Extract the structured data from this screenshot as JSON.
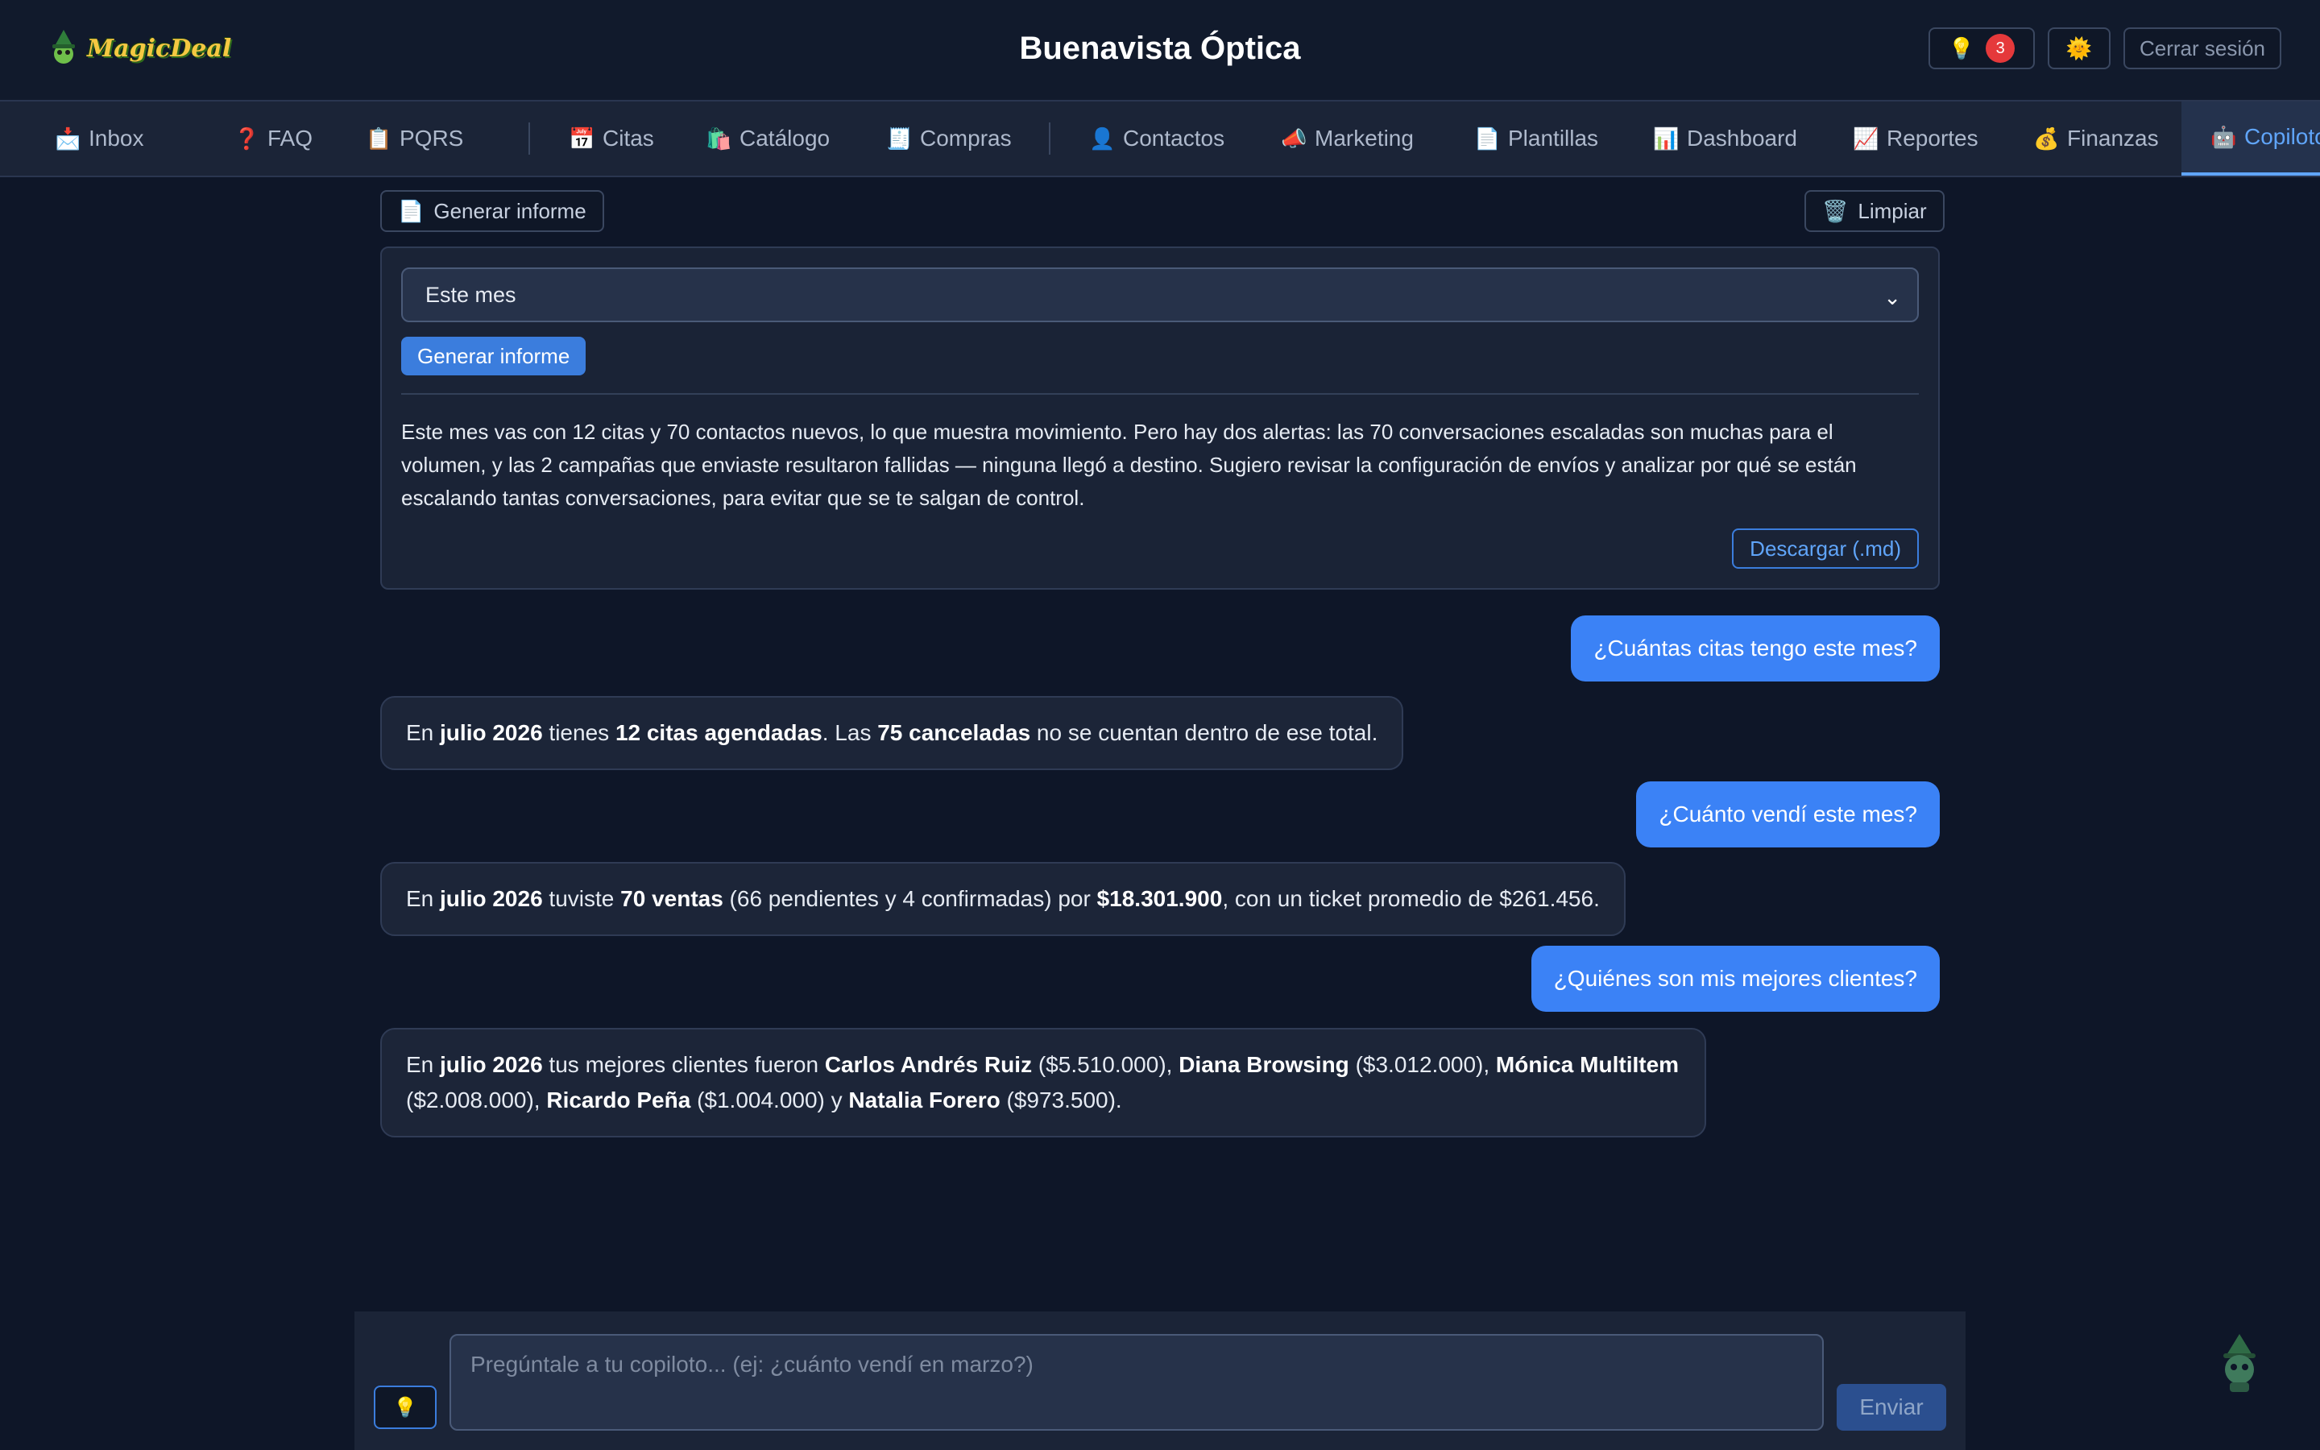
{
  "header": {
    "logo_text": "MagicDeal",
    "title": "Buenavista Óptica",
    "tips_badge": "3",
    "logout_label": "Cerrar sesión"
  },
  "nav": {
    "items": [
      {
        "icon": "📩",
        "label": "Inbox"
      },
      {
        "icon": "❓",
        "label": "FAQ"
      },
      {
        "icon": "📋",
        "label": "PQRS"
      },
      {
        "icon": "📅",
        "label": "Citas"
      },
      {
        "icon": "🛍️",
        "label": "Catálogo"
      },
      {
        "icon": "🧾",
        "label": "Compras"
      },
      {
        "icon": "👤",
        "label": "Contactos"
      },
      {
        "icon": "📣",
        "label": "Marketing"
      },
      {
        "icon": "📄",
        "label": "Plantillas"
      },
      {
        "icon": "📊",
        "label": "Dashboard"
      },
      {
        "icon": "📈",
        "label": "Reportes"
      },
      {
        "icon": "💰",
        "label": "Finanzas"
      },
      {
        "icon": "🤖",
        "label": "Copiloto"
      }
    ],
    "active": "Copiloto"
  },
  "toolbar": {
    "generate_label": "Generar informe",
    "clear_label": "Limpiar"
  },
  "report": {
    "period_selected": "Este mes",
    "generate_button": "Generar informe",
    "summary": "Este mes vas con 12 citas y 70 contactos nuevos, lo que muestra movimiento. Pero hay dos alertas: las 70 conversaciones escaladas son muchas para el volumen, y las 2 campañas que enviaste resultaron fallidas — ninguna llegó a destino. Sugiero revisar la configuración de envíos y analizar por qué se están escalando tantas conversaciones, para evitar que se te salgan de control.",
    "download_label": "Descargar (.md)"
  },
  "chat": {
    "q1": "¿Cuántas citas tengo este mes?",
    "a1": {
      "p1": "En ",
      "b1": "julio 2026",
      "p2": " tienes ",
      "b2": "12 citas agendadas",
      "p3": ". Las ",
      "b3": "75 canceladas",
      "p4": " no se cuentan dentro de ese total."
    },
    "q2": "¿Cuánto vendí este mes?",
    "a2": {
      "p1": "En ",
      "b1": "julio 2026",
      "p2": " tuviste ",
      "b2": "70 ventas",
      "p3": " (66 pendientes y 4 confirmadas) por ",
      "b3": "$18.301.900",
      "p4": ", con un ticket promedio de $261.456."
    },
    "q3": "¿Quiénes son mis mejores clientes?",
    "a3": {
      "p1": "En ",
      "b1": "julio 2026",
      "p2": " tus mejores clientes fueron ",
      "c1": "Carlos Andrés Ruiz",
      "v1": " ($5.510.000), ",
      "c2": "Diana Browsing",
      "v2": " ($3.012.000), ",
      "c3": "Mónica MultiItem",
      "v3": " ($2.008.000), ",
      "c4": "Ricardo Peña",
      "v4": " ($1.004.000) y ",
      "c5": "Natalia Forero",
      "v5": " ($973.500)."
    }
  },
  "composer": {
    "placeholder": "Pregúntale a tu copiloto... (ej: ¿cuánto vendí en marzo?)",
    "send_label": "Enviar"
  }
}
